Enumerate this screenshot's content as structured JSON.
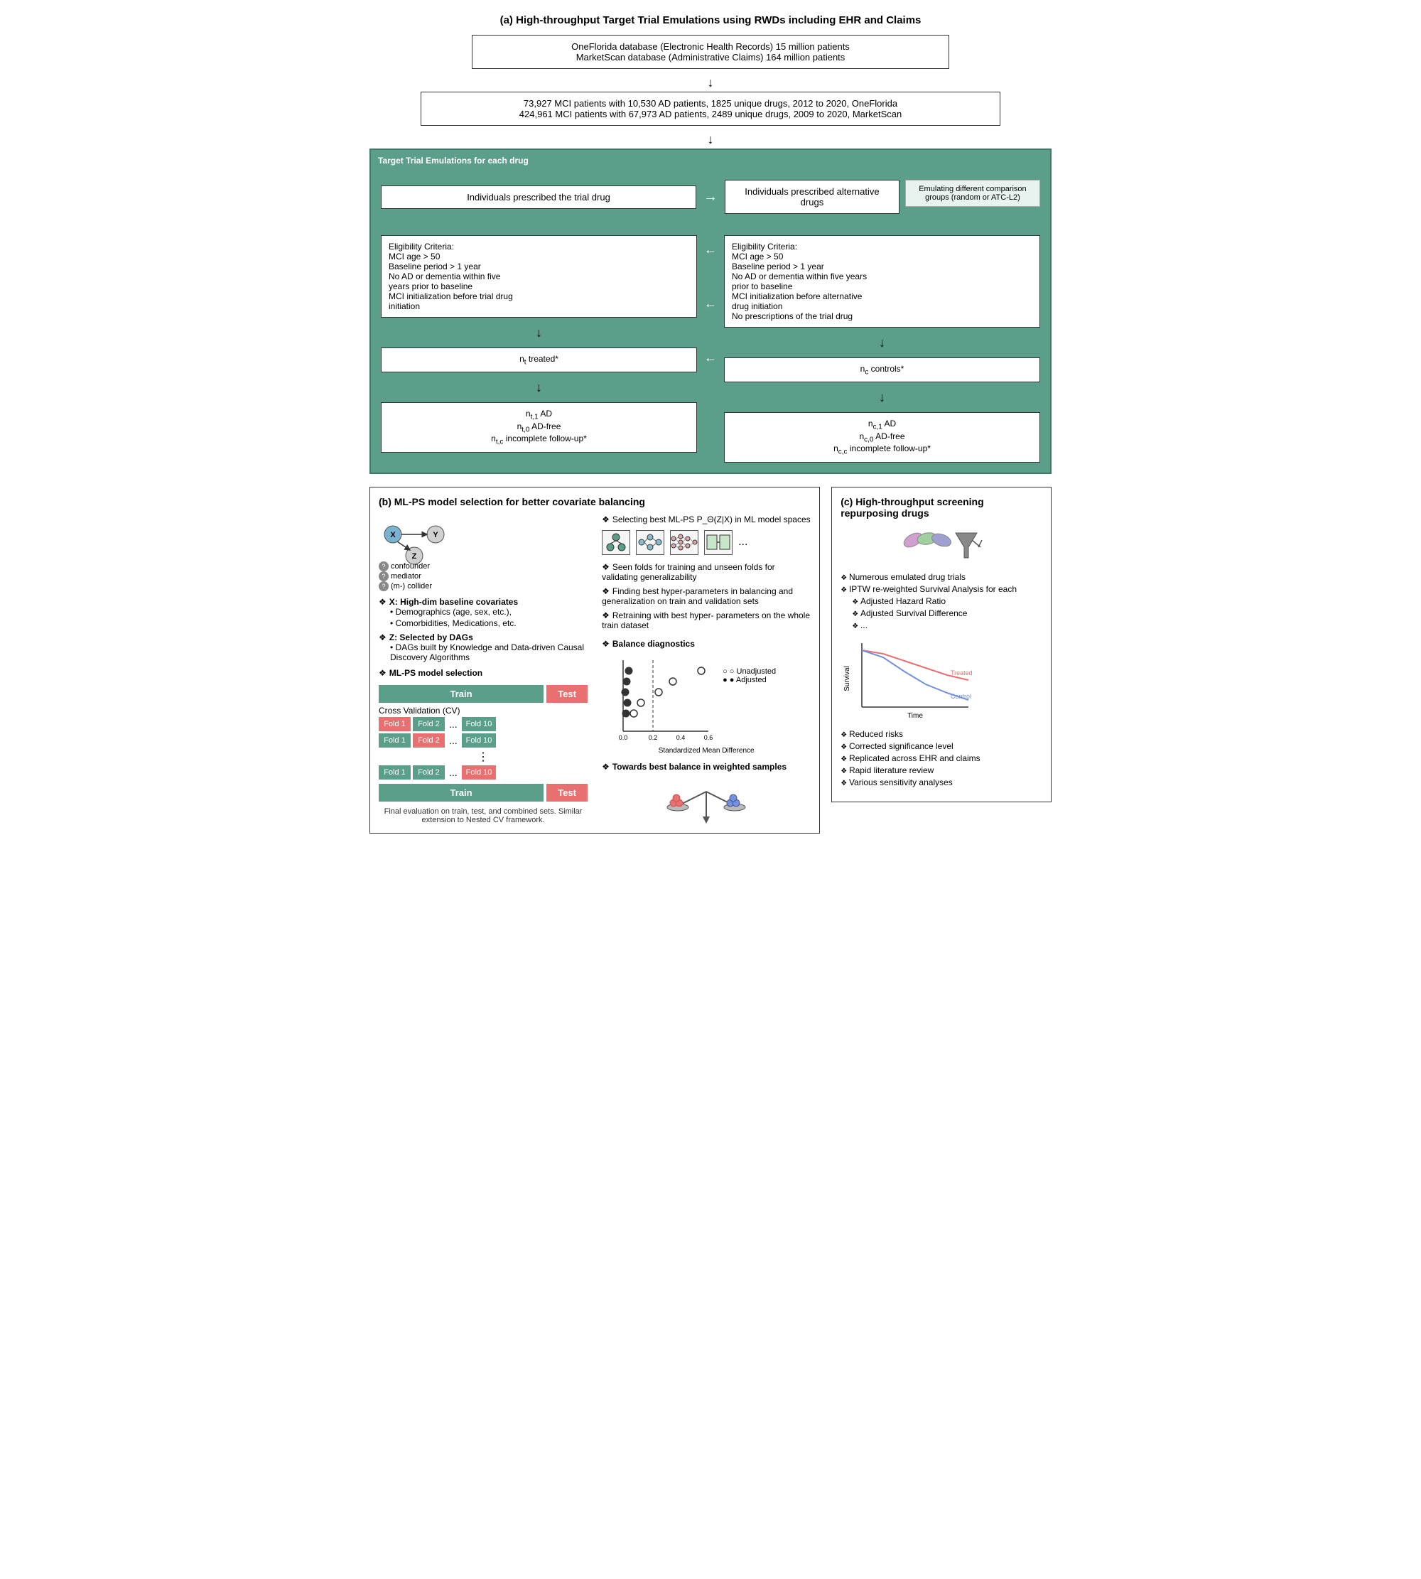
{
  "sectionA": {
    "title": "(a) High-throughput Target Trial Emulations using RWDs including EHR and Claims",
    "db1": "OneFlorida database (Electronic Health Records) 15 million patients",
    "db2": "MarketScan database (Administrative Claims) 164 million patients",
    "mci1": "73,927 MCI patients with 10,530 AD patients, 1825 unique drugs, 2012 to 2020, OneFlorida",
    "mci2": "424,961 MCI patients with 67,973 AD patients, 2489 unique drugs, 2009 to 2020, MarketScan",
    "tteLabel": "Target Trial Emulations for each drug",
    "col1Header": "Individuals prescribed the trial drug",
    "col2Header": "Individuals prescribed alternative drugs",
    "rightNote": "Emulating different comparison groups (random or ATC-L2)",
    "eligLeft": "Eligibility Criteria:\nMCI age > 50\nBaseline period > 1 year\nNo AD or dementia within five years prior to baseline\nMCI initialization before trial drug initiation",
    "eligRight": "Eligibility Criteria:\nMCI age > 50\nBaseline period > 1 year\nNo AD or dementia within five years prior to baseline\nMCI initialization before alternative drug initiation\nNo prescriptions of the trial drug",
    "treated": "n_t treated*",
    "controls": "n_c controls*",
    "outLeft": "n_{t,1} AD\nn_{t,0} AD-free\nn_{t,c} incomplete follow-up*",
    "outRight": "n_{c,1} AD\nn_{c,0} AD-free\nn_{c,c} incomplete follow-up*"
  },
  "sectionB": {
    "title": "(b) ML-PS model selection for better covariate balancing",
    "xLabel": "X: High-dim baseline covariates",
    "xBullets": [
      "Demographics (age, sex, etc.),",
      "Comorbidities, Medications, etc."
    ],
    "zLabel": "Z: Selected by DAGs",
    "zBullets": [
      "DAGs built by Knowledge and Data-driven Causal Discovery Algorithms"
    ],
    "mlpsLabel": "ML-PS model selection",
    "trainLabel": "Train",
    "testLabel": "Test",
    "cvLabel": "Cross Validation (CV)",
    "folds": [
      "Fold 1",
      "Fold 2",
      "...",
      "Fold 10"
    ],
    "vdots": "⋮",
    "footnote": "Final evaluation on train, test, and combined sets.\nSimilar extension to Nested CV framework.",
    "selectingLabel": "Selecting best ML-PS P_Θ(Z|X) in ML model spaces",
    "balanceLabel": "Balance diagnostics",
    "unadjusted": "○ Unadjusted",
    "adjusted": "● Adjusted",
    "xaxisLabel": "Standardized Mean Difference",
    "bestBalanceLabel": "Towards best balance in weighted samples",
    "seenFoldsText": "Seen folds for training and unseen folds for validating generalizability",
    "findingBestText": "Finding best hyper-parameters in balancing and generalization on train and validation sets",
    "retrainingText": "Retraining with best hyper- parameters on the whole train dataset"
  },
  "sectionC": {
    "title": "(c) High-throughput screening repurposing drugs",
    "bullets": [
      "Numerous emulated drug trials",
      "IPTW re-weighted Survival Analysis for each",
      "Adjusted Hazard Ratio",
      "Adjusted Survival Difference",
      "..."
    ],
    "survivalLabels": {
      "yAxis": "Survival",
      "xAxis": "Time",
      "treated": "Treated",
      "control": "Control"
    },
    "bottomBullets": [
      "Reduced risks",
      "Corrected significance level",
      "Replicated across EHR and claims",
      "Rapid literature review",
      "Various sensitivity analyses"
    ]
  }
}
